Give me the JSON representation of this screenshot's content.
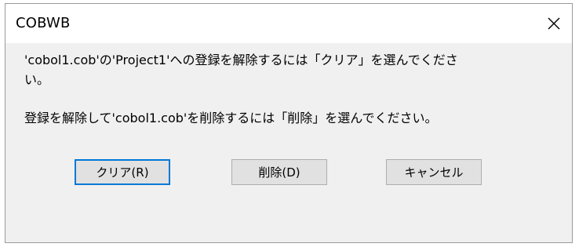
{
  "window": {
    "title": "COBWB"
  },
  "message": {
    "line1": "'cobol1.cob'の'Project1'への登録を解除するには「クリア」を選んでくださ",
    "line2": "い。",
    "line3": "登録を解除して'cobol1.cob'を削除するには「削除」を選んでください。"
  },
  "buttons": {
    "clear_label": "クリア(R)",
    "delete_label": "削除(D)",
    "cancel_label": "キャンセル"
  },
  "icons": {
    "close": "close-icon"
  }
}
